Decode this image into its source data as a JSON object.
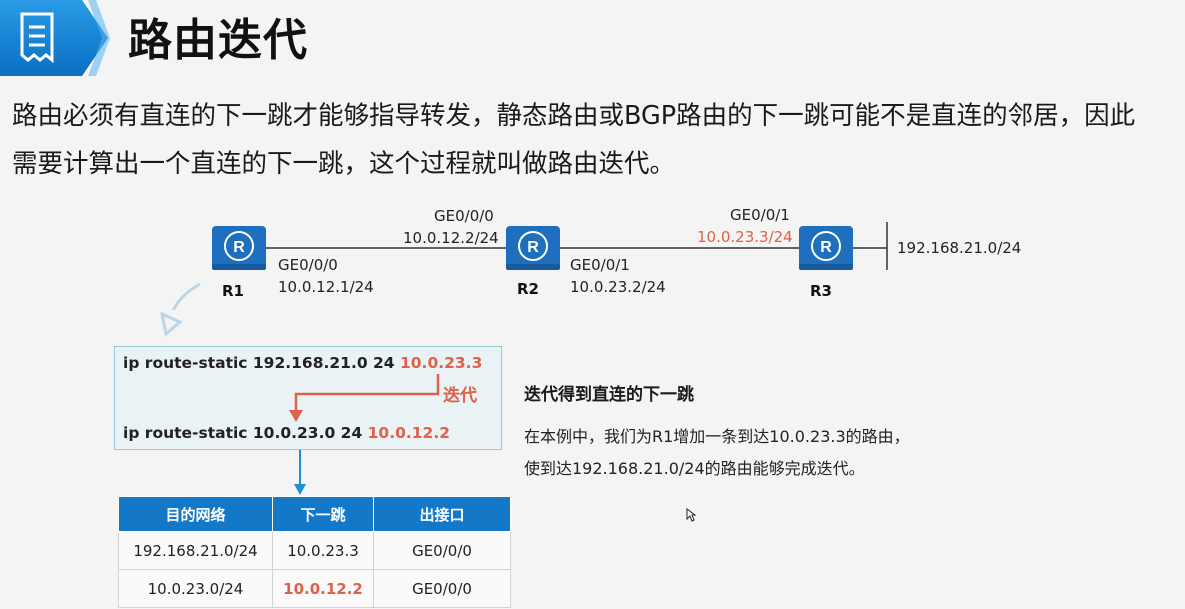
{
  "header": {
    "title": "路由迭代"
  },
  "intro": {
    "line1": "路由必须有直连的下一跳才能够指导转发，静态路由或BGP路由的下一跳可能不是直连的邻居，因此",
    "line2": "需要计算出一个直连的下一跳，这个过程就叫做路由迭代。"
  },
  "topology": {
    "routers": [
      {
        "name": "R1"
      },
      {
        "name": "R2"
      },
      {
        "name": "R3"
      }
    ],
    "links": {
      "r1_if": "GE0/0/0",
      "r1_ip": "10.0.12.1/24",
      "r2_left_if": "GE0/0/0",
      "r2_left_ip": "10.0.12.2/24",
      "r2_right_if": "GE0/0/1",
      "r2_right_ip": "10.0.23.2/24",
      "r3_if": "GE0/0/1",
      "r3_ip": "10.0.23.3/24"
    },
    "stub_network": "192.168.21.0/24"
  },
  "static_routes": {
    "route1_prefix": "ip route-static 192.168.21.0 24 ",
    "route1_nexthop": "10.0.23.3",
    "iteration_label": "迭代",
    "route2_prefix": "ip route-static 10.0.23.0 24 ",
    "route2_nexthop": "10.0.12.2"
  },
  "routing_table": {
    "headers": [
      "目的网络",
      "下一跳",
      "出接口"
    ],
    "rows": [
      [
        "192.168.21.0/24",
        "10.0.23.3",
        "GE0/0/0"
      ],
      [
        "10.0.23.0/24",
        "10.0.12.2",
        "GE0/0/0"
      ]
    ]
  },
  "explanation": {
    "title": "迭代得到直连的下一跳",
    "line1": "在本例中，我们为R1增加一条到达10.0.23.3的路由，",
    "line2": "使到达192.168.21.0/24的路由能够完成迭代。"
  },
  "colors": {
    "accent_blue": "#1478c8",
    "highlight_red": "#e0614a",
    "router_blue": "#1f6fbf"
  }
}
